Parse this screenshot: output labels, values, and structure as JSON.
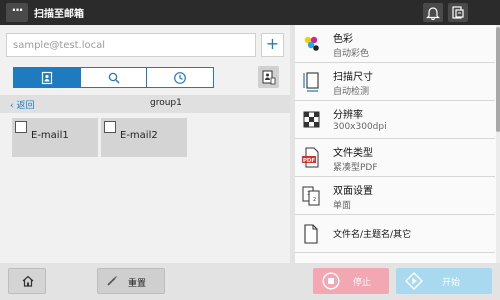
{
  "header": {
    "title": "扫描至邮箱",
    "menu_glyph": "···",
    "icons": [
      "bell-icon",
      "device-icon"
    ]
  },
  "address": {
    "placeholder": "sample@test.local",
    "add_label": "+"
  },
  "tabs": [
    {
      "icon": "address-book-icon",
      "selected": true
    },
    {
      "icon": "search-icon",
      "selected": false
    },
    {
      "icon": "clock-icon",
      "selected": false
    }
  ],
  "breadcrumb": {
    "back_label": "返回",
    "group": "group1"
  },
  "destinations": [
    {
      "label": "E-mail1",
      "checked": false
    },
    {
      "label": "E-mail2",
      "checked": false
    }
  ],
  "settings": [
    {
      "name": "色彩",
      "value": "自动彩色",
      "icon": "color-icon"
    },
    {
      "name": "扫描尺寸",
      "value": "自动检测",
      "icon": "scan-size-icon"
    },
    {
      "name": "分辨率",
      "value": "300x300dpi",
      "icon": "resolution-icon"
    },
    {
      "name": "文件类型",
      "value": "紧凑型PDF",
      "icon": "pdf-icon"
    },
    {
      "name": "双面设置",
      "value": "单面",
      "icon": "duplex-icon"
    },
    {
      "name": "文件名/主题名/其它",
      "value": "",
      "icon": "document-icon"
    }
  ],
  "bottom": {
    "reset_label": "重置",
    "stop_label": "停止",
    "start_label": "开始"
  },
  "colors": {
    "accent": "#1f7bbf",
    "stop": "#f2a7b2",
    "start": "#a9d9ef",
    "topbar": "#2b2b2b"
  }
}
